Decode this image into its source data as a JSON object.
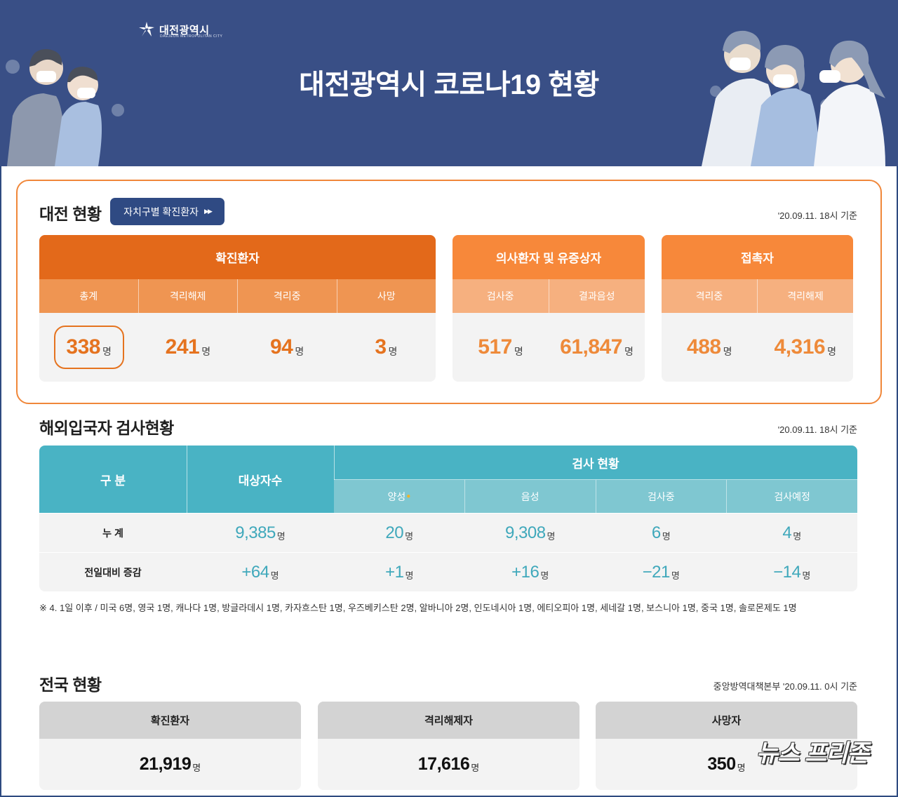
{
  "banner": {
    "logo_text": "대전광역시",
    "logo_sub": "DAEJEON METROPOLITAN CITY",
    "title": "대전광역시 코로나19 현황"
  },
  "daejeon": {
    "title": "대전 현황",
    "district_button": "자치구별 확진환자",
    "stamp": "'20.09.11. 18시 기준",
    "confirmed": {
      "header": "확진환자",
      "cols": [
        "총계",
        "격리해제",
        "격리중",
        "사망"
      ],
      "values": [
        "338",
        "241",
        "94",
        "3"
      ]
    },
    "suspected": {
      "header": "의사환자 및 유증상자",
      "cols": [
        "검사중",
        "결과음성"
      ],
      "values": [
        "517",
        "61,847"
      ]
    },
    "contacts": {
      "header": "접촉자",
      "cols": [
        "격리중",
        "격리해제"
      ],
      "values": [
        "488",
        "4,316"
      ]
    },
    "unit": "명"
  },
  "overseas": {
    "title": "해외입국자 검사현황",
    "stamp": "'20.09.11. 18시 기준",
    "head_category": "구 분",
    "head_total": "대상자수",
    "head_test": "검사 현황",
    "sub_cols": [
      "양성",
      "음성",
      "검사중",
      "검사예정"
    ],
    "positive_mark": "●",
    "rows": [
      {
        "label": "누 계",
        "total": "9,385",
        "values": [
          "20",
          "9,308",
          "6",
          "4"
        ]
      },
      {
        "label": "전일대비 증감",
        "total": "+64",
        "values": [
          "+1",
          "+16",
          "−21",
          "−14"
        ]
      }
    ],
    "unit": "명",
    "note": "※ 4. 1일 이후 / 미국 6명, 영국 1명, 캐나다 1명, 방글라데시 1명, 카자흐스탄 1명, 우즈베키스탄 2명, 알바니아 2명, 인도네시아 1명, 에티오피아 1명, 세네갈 1명, 보스니아 1명, 중국 1명, 솔로몬제도 1명"
  },
  "national": {
    "title": "전국 현황",
    "stamp": "중앙방역대책본부 '20.09.11. 0시 기준",
    "cards": [
      {
        "label": "확진환자",
        "value": "21,919"
      },
      {
        "label": "격리해제자",
        "value": "17,616"
      },
      {
        "label": "사망자",
        "value": "350"
      }
    ],
    "unit": "명"
  },
  "watermark": "뉴스 프리존"
}
